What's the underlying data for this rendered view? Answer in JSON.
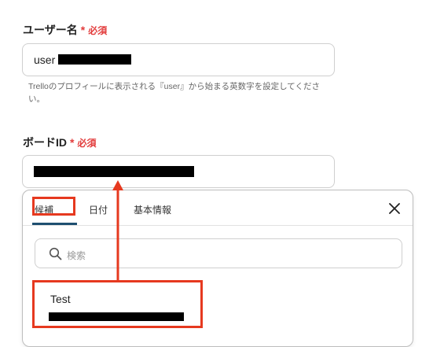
{
  "username_field": {
    "label": "ユーザー名",
    "required_star": "*",
    "required_text": "必須",
    "value_prefix": "user",
    "help_text": "Trelloのプロフィールに表示される『user』から始まる英数字を設定してください。"
  },
  "board_field": {
    "label": "ボードID",
    "required_star": "*",
    "required_text": "必須"
  },
  "dropdown": {
    "tabs": [
      {
        "label": "候補",
        "active": true
      },
      {
        "label": "日付",
        "active": false
      },
      {
        "label": "基本情報",
        "active": false
      }
    ],
    "search_placeholder": "検索",
    "options": [
      {
        "title": "Test"
      }
    ]
  },
  "colors": {
    "required": "#e23b3b",
    "highlight": "#e6391f",
    "tab_underline": "#1e4f70"
  }
}
